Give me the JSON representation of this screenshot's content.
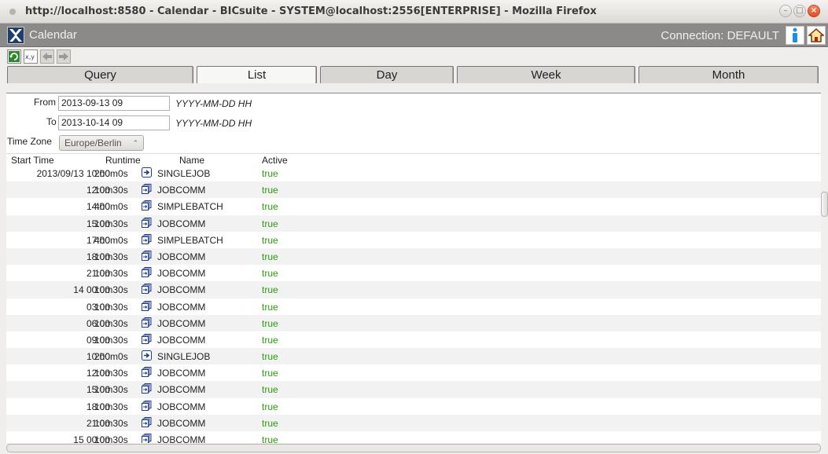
{
  "window": {
    "title": "http://localhost:8580 - Calendar - BICsuite - SYSTEM@localhost:2556[ENTERPRISE] - Mozilla Firefox"
  },
  "header": {
    "app_name": "Calendar",
    "connection": "Connection: DEFAULT"
  },
  "toolbar": {
    "buttons": [
      "refresh-icon",
      "xy-icon",
      "back-arrow-icon",
      "forward-arrow-icon"
    ]
  },
  "tabs": [
    {
      "label": "Query",
      "active": false
    },
    {
      "label": "List",
      "active": true
    },
    {
      "label": "Day",
      "active": false
    },
    {
      "label": "Week",
      "active": false
    },
    {
      "label": "Month",
      "active": false
    }
  ],
  "form": {
    "from_label": "From",
    "from_value": "2013-09-13 09",
    "from_hint": "YYYY-MM-DD HH",
    "to_label": "To",
    "to_value": "2013-10-14 09",
    "to_hint": "YYYY-MM-DD HH",
    "tz_label": "Time Zone",
    "tz_value": "Europe/Berlin"
  },
  "table": {
    "headers": [
      "Start Time",
      "Runtime",
      "Name",
      "Active"
    ],
    "rows": [
      {
        "start": "2013/09/13 10:00",
        "runtime": "2h0m0s",
        "icon": "job-icon",
        "name": "SINGLEJOB",
        "active": "true"
      },
      {
        "start": "12:00",
        "runtime": "10m30s",
        "icon": "batch-icon",
        "name": "JOBCOMM",
        "active": "true"
      },
      {
        "start": "14:00",
        "runtime": "4h0m0s",
        "icon": "batch-icon",
        "name": "SIMPLEBATCH",
        "active": "true"
      },
      {
        "start": "15:00",
        "runtime": "10m30s",
        "icon": "batch-icon",
        "name": "JOBCOMM",
        "active": "true"
      },
      {
        "start": "17:00",
        "runtime": "4h0m0s",
        "icon": "batch-icon",
        "name": "SIMPLEBATCH",
        "active": "true"
      },
      {
        "start": "18:00",
        "runtime": "10m30s",
        "icon": "batch-icon",
        "name": "JOBCOMM",
        "active": "true"
      },
      {
        "start": "21:00",
        "runtime": "10m30s",
        "icon": "batch-icon",
        "name": "JOBCOMM",
        "active": "true"
      },
      {
        "start": "14 00:00",
        "runtime": "10m30s",
        "icon": "batch-icon",
        "name": "JOBCOMM",
        "active": "true"
      },
      {
        "start": "03:00",
        "runtime": "10m30s",
        "icon": "batch-icon",
        "name": "JOBCOMM",
        "active": "true"
      },
      {
        "start": "06:00",
        "runtime": "10m30s",
        "icon": "batch-icon",
        "name": "JOBCOMM",
        "active": "true"
      },
      {
        "start": "09:00",
        "runtime": "10m30s",
        "icon": "batch-icon",
        "name": "JOBCOMM",
        "active": "true"
      },
      {
        "start": "10:00",
        "runtime": "2h0m0s",
        "icon": "job-icon",
        "name": "SINGLEJOB",
        "active": "true"
      },
      {
        "start": "12:00",
        "runtime": "10m30s",
        "icon": "batch-icon",
        "name": "JOBCOMM",
        "active": "true"
      },
      {
        "start": "15:00",
        "runtime": "10m30s",
        "icon": "batch-icon",
        "name": "JOBCOMM",
        "active": "true"
      },
      {
        "start": "18:00",
        "runtime": "10m30s",
        "icon": "batch-icon",
        "name": "JOBCOMM",
        "active": "true"
      },
      {
        "start": "21:00",
        "runtime": "10m30s",
        "icon": "batch-icon",
        "name": "JOBCOMM",
        "active": "true"
      },
      {
        "start": "15 00:00",
        "runtime": "10m30s",
        "icon": "batch-icon",
        "name": "JOBCOMM",
        "active": "true"
      }
    ]
  },
  "colors": {
    "active_true": "#2a9d0b",
    "header_bg": "#8b8a88",
    "row_alt": "#f2f2f2"
  }
}
